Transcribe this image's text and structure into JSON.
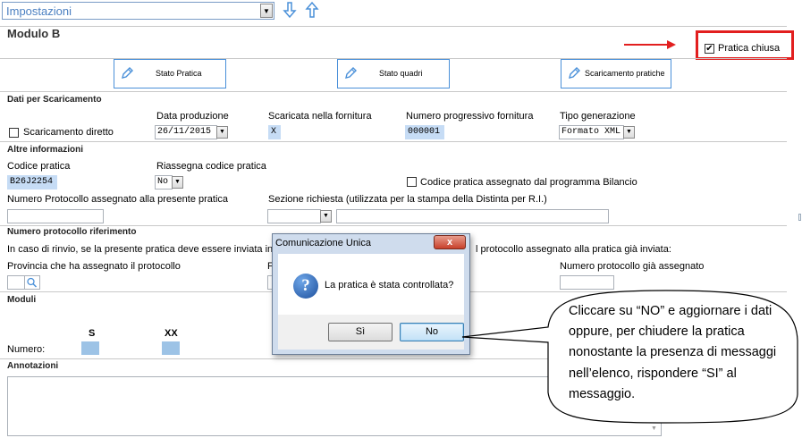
{
  "toolbar": {
    "select_value": "Impostazioni",
    "down_arrow_icon": "arrow-down-icon",
    "up_arrow_icon": "arrow-up-icon"
  },
  "header": {
    "title": "Modulo B",
    "pratica_chiusa_label": "Pratica chiusa",
    "pratica_chiusa_checked": "✔"
  },
  "buttons": {
    "stato_pratica": "Stato Pratica",
    "stato_quadri": "Stato quadri",
    "scaricamento_pratiche": "Scaricamento pratiche"
  },
  "scaricamento": {
    "section_title": "Dati per Scaricamento",
    "diretto_label": "Scaricamento diretto",
    "data_produzione_label": "Data produzione",
    "data_produzione_value": "26/11/2015",
    "scaricata_label": "Scaricata nella fornitura",
    "scaricata_value": "X",
    "numero_prog_label": "Numero progressivo fornitura",
    "numero_prog_value": "000001",
    "tipo_gen_label": "Tipo generazione",
    "tipo_gen_value": "Formato XML"
  },
  "altre": {
    "section_title": "Altre informazioni",
    "codice_pratica_label": "Codice pratica",
    "codice_pratica_value": "B26J2254",
    "riassegna_label": "Riassegna codice pratica",
    "riassegna_value": "No",
    "codice_bilancio_label": "Codice pratica assegnato dal programma Bilancio",
    "numero_protocollo_label": "Numero Protocollo assegnato alla presente pratica",
    "sezione_label": "Sezione richiesta (utilizzata per la stampa della Distinta per R.I.)"
  },
  "riferimento": {
    "section_title": "Numero protocollo riferimento",
    "rinvio_text_left": "In caso di rinvio, se la presente pratica deve essere inviata in so",
    "rinvio_text_right": "l protocollo assegnato alla pratica già inviata:",
    "provincia_label": "Provincia che ha assegnato il protocollo",
    "numero_gia_label": "Numero protocollo già assegnato",
    "partial_label": "F"
  },
  "moduli": {
    "section_title": "Moduli",
    "col_s": "S",
    "col_xx": "XX",
    "numero_label": "Numero:"
  },
  "annotazioni": {
    "section_title": "Annotazioni"
  },
  "dialog": {
    "title": "Comunicazione Unica",
    "close_label": "x",
    "message": "La pratica è stata controllata?",
    "yes_label": "Sì",
    "no_label": "No"
  },
  "callout": {
    "text": "Cliccare su “NO” e aggiornare i dati oppure, per chiudere la pratica nonostante la presenza di messaggi nell’elenco, rispondere “SI” al messaggio."
  },
  "colors": {
    "accent_blue": "#4a90d9",
    "highlight_red": "#e21f1f",
    "field_highlight": "#c6dcf5"
  }
}
